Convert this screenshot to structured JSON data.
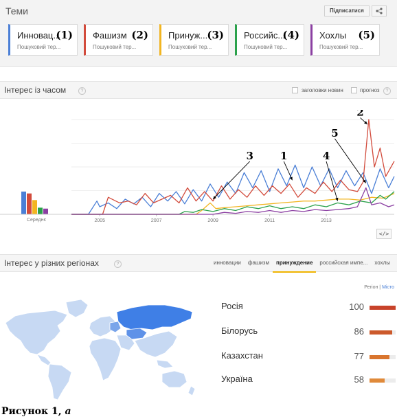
{
  "topics": {
    "title": "Теми",
    "subscribe_label": "Підписатися",
    "share_icon": "share-icon",
    "cards": [
      {
        "name": "Инновац...",
        "sub": "Пошуковий тер...",
        "num": "(1)",
        "color": "#4a7fd6"
      },
      {
        "name": "Фашизм",
        "sub": "Пошуковий тер...",
        "num": "(2)",
        "color": "#d24b3c"
      },
      {
        "name": "Принуж...",
        "sub": "Пошуковий тер...",
        "num": "(3)",
        "color": "#f2b521"
      },
      {
        "name": "Российс...",
        "sub": "Пошуковий тер...",
        "num": "(4)",
        "color": "#2ba14b"
      },
      {
        "name": "Хохлы",
        "sub": "Пошуковий тер...",
        "num": "(5)",
        "color": "#8b3fa2"
      }
    ]
  },
  "interest_over_time": {
    "title": "Інтерес із часом",
    "news_headlines_label": "заголовки новин",
    "forecast_label": "прогноз",
    "embed_label": "</>"
  },
  "chart_data": {
    "type": "line",
    "x_ticks": [
      "2005",
      "2007",
      "2009",
      "2011",
      "2013"
    ],
    "average_label": "Середнє",
    "averages": [
      {
        "term": "(1)",
        "color": "#4a7fd6",
        "value": 24
      },
      {
        "term": "(2)",
        "color": "#d24b3c",
        "value": 22
      },
      {
        "term": "(3)",
        "color": "#f2b521",
        "value": 15
      },
      {
        "term": "(4)",
        "color": "#2ba14b",
        "value": 7
      },
      {
        "term": "(5)",
        "color": "#8b3fa2",
        "value": 6
      }
    ],
    "ylim": [
      0,
      100
    ],
    "x_range": [
      2004,
      2015.4
    ],
    "series": [
      {
        "term": "(1)",
        "color": "#4a7fd6",
        "points": [
          [
            2004,
            0
          ],
          [
            2004.6,
            0
          ],
          [
            2004.9,
            14
          ],
          [
            2005.0,
            8
          ],
          [
            2005.3,
            12
          ],
          [
            2005.6,
            6
          ],
          [
            2005.9,
            16
          ],
          [
            2006.2,
            11
          ],
          [
            2006.5,
            18
          ],
          [
            2006.8,
            8
          ],
          [
            2007.1,
            22
          ],
          [
            2007.4,
            14
          ],
          [
            2007.7,
            24
          ],
          [
            2008.0,
            11
          ],
          [
            2008.3,
            26
          ],
          [
            2008.6,
            14
          ],
          [
            2008.9,
            32
          ],
          [
            2009.2,
            18
          ],
          [
            2009.5,
            34
          ],
          [
            2009.8,
            22
          ],
          [
            2010.1,
            44
          ],
          [
            2010.4,
            28
          ],
          [
            2010.7,
            46
          ],
          [
            2011.0,
            24
          ],
          [
            2011.3,
            48
          ],
          [
            2011.6,
            30
          ],
          [
            2011.9,
            52
          ],
          [
            2012.2,
            28
          ],
          [
            2012.5,
            50
          ],
          [
            2012.8,
            30
          ],
          [
            2013.1,
            48
          ],
          [
            2013.4,
            28
          ],
          [
            2013.7,
            46
          ],
          [
            2014.0,
            30
          ],
          [
            2014.3,
            44
          ],
          [
            2014.6,
            22
          ],
          [
            2014.9,
            48
          ],
          [
            2015.2,
            28
          ],
          [
            2015.4,
            40
          ]
        ]
      },
      {
        "term": "(2)",
        "color": "#d24b3c",
        "points": [
          [
            2004,
            0
          ],
          [
            2005.1,
            0
          ],
          [
            2005.3,
            18
          ],
          [
            2005.7,
            12
          ],
          [
            2006.0,
            14
          ],
          [
            2006.3,
            10
          ],
          [
            2006.6,
            22
          ],
          [
            2006.9,
            12
          ],
          [
            2007.2,
            16
          ],
          [
            2007.5,
            20
          ],
          [
            2007.8,
            12
          ],
          [
            2008.1,
            28
          ],
          [
            2008.4,
            14
          ],
          [
            2008.7,
            24
          ],
          [
            2009.0,
            14
          ],
          [
            2009.3,
            30
          ],
          [
            2009.6,
            16
          ],
          [
            2009.9,
            26
          ],
          [
            2010.2,
            18
          ],
          [
            2010.5,
            30
          ],
          [
            2010.8,
            20
          ],
          [
            2011.1,
            30
          ],
          [
            2011.4,
            22
          ],
          [
            2011.7,
            32
          ],
          [
            2012.0,
            18
          ],
          [
            2012.3,
            28
          ],
          [
            2012.6,
            22
          ],
          [
            2012.9,
            34
          ],
          [
            2013.2,
            24
          ],
          [
            2013.5,
            36
          ],
          [
            2013.8,
            26
          ],
          [
            2014.1,
            24
          ],
          [
            2014.3,
            34
          ],
          [
            2014.5,
            100
          ],
          [
            2014.7,
            50
          ],
          [
            2014.9,
            70
          ],
          [
            2015.1,
            40
          ],
          [
            2015.4,
            56
          ]
        ]
      },
      {
        "term": "(3)",
        "color": "#f2b521",
        "points": [
          [
            2004,
            0
          ],
          [
            2008.4,
            0
          ],
          [
            2008.6,
            4
          ],
          [
            2008.9,
            12
          ],
          [
            2009.1,
            6
          ],
          [
            2009.4,
            7
          ],
          [
            2009.8,
            8
          ],
          [
            2010.2,
            9
          ],
          [
            2010.6,
            10
          ],
          [
            2011.0,
            11
          ],
          [
            2011.4,
            12
          ],
          [
            2011.8,
            13
          ],
          [
            2012.2,
            14
          ],
          [
            2012.6,
            14
          ],
          [
            2013.0,
            15
          ],
          [
            2013.4,
            16
          ],
          [
            2013.8,
            16
          ],
          [
            2014.2,
            15
          ],
          [
            2014.6,
            18
          ],
          [
            2015.0,
            17
          ],
          [
            2015.4,
            22
          ]
        ]
      },
      {
        "term": "(4)",
        "color": "#2ba14b",
        "points": [
          [
            2004,
            0
          ],
          [
            2007.8,
            0
          ],
          [
            2008.0,
            3
          ],
          [
            2008.3,
            2
          ],
          [
            2008.6,
            5
          ],
          [
            2009.0,
            3
          ],
          [
            2009.4,
            6
          ],
          [
            2009.8,
            4
          ],
          [
            2010.2,
            8
          ],
          [
            2010.6,
            6
          ],
          [
            2011.0,
            9
          ],
          [
            2011.4,
            6
          ],
          [
            2011.8,
            8
          ],
          [
            2012.2,
            6
          ],
          [
            2012.6,
            10
          ],
          [
            2013.0,
            8
          ],
          [
            2013.4,
            12
          ],
          [
            2013.8,
            10
          ],
          [
            2014.2,
            14
          ],
          [
            2014.6,
            12
          ],
          [
            2014.9,
            20
          ],
          [
            2015.1,
            16
          ],
          [
            2015.4,
            24
          ]
        ]
      },
      {
        "term": "(5)",
        "color": "#8b3fa2",
        "points": [
          [
            2004,
            0
          ],
          [
            2009.0,
            0
          ],
          [
            2009.4,
            2
          ],
          [
            2009.8,
            1
          ],
          [
            2010.2,
            3
          ],
          [
            2010.6,
            2
          ],
          [
            2011.0,
            4
          ],
          [
            2011.4,
            2
          ],
          [
            2011.8,
            4
          ],
          [
            2012.2,
            3
          ],
          [
            2012.6,
            5
          ],
          [
            2013.0,
            4
          ],
          [
            2013.4,
            5
          ],
          [
            2013.8,
            6
          ],
          [
            2014.1,
            8
          ],
          [
            2014.4,
            28
          ],
          [
            2014.6,
            10
          ],
          [
            2014.9,
            12
          ],
          [
            2015.2,
            8
          ],
          [
            2015.4,
            10
          ]
        ]
      }
    ],
    "annotations": [
      {
        "label": "1",
        "text_at": [
          2011.5,
          58
        ],
        "arrow_to": [
          2011.8,
          36
        ]
      },
      {
        "label": "2",
        "text_at": [
          2014.2,
          104
        ],
        "arrow_to": [
          2014.45,
          95
        ]
      },
      {
        "label": "3",
        "text_at": [
          2010.3,
          58
        ],
        "arrow_to": [
          2009.0,
          16
        ]
      },
      {
        "label": "4",
        "text_at": [
          2013.0,
          58
        ],
        "arrow_to": [
          2013.4,
          14
        ]
      },
      {
        "label": "5",
        "text_at": [
          2013.3,
          82
        ],
        "arrow_to": [
          2014.4,
          33
        ]
      }
    ]
  },
  "interest_by_region": {
    "title": "Інтерес у різних регіонах",
    "tabs": [
      {
        "label": "инновации",
        "active": false
      },
      {
        "label": "фашизм",
        "active": false
      },
      {
        "label": "принуждение",
        "active": true
      },
      {
        "label": "российская импе...",
        "active": false
      },
      {
        "label": "хохлы",
        "active": false
      }
    ],
    "toggle_region": "Регіон",
    "toggle_sep": "|",
    "toggle_city": "Місто",
    "regions": [
      {
        "name": "Росія",
        "value": 100,
        "color": "#c8432a"
      },
      {
        "name": "Білорусь",
        "value": 86,
        "color": "#cc5a2c"
      },
      {
        "name": "Казахстан",
        "value": 77,
        "color": "#d9752e"
      },
      {
        "name": "Україна",
        "value": 58,
        "color": "#e08a3a"
      }
    ]
  },
  "caption": {
    "text": "Рисунок 1,",
    "letter": "а"
  }
}
